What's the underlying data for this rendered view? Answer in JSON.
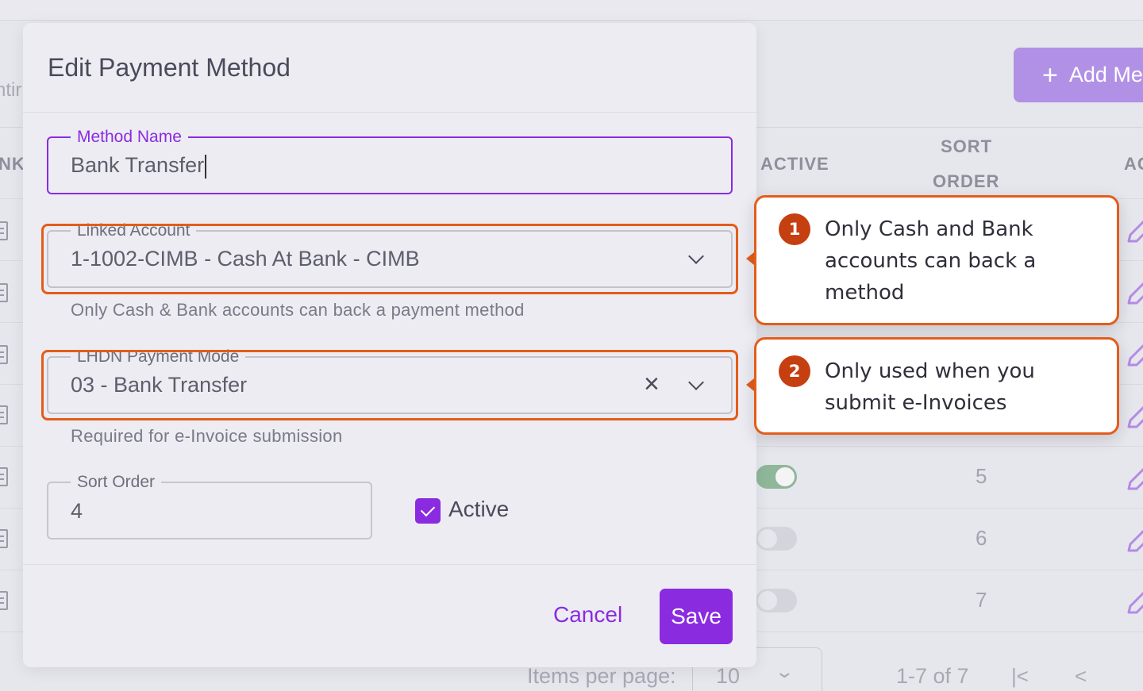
{
  "background": {
    "left_fragment": "ntir",
    "add_button_label": "Add Me",
    "add_button_icon": "plus-icon",
    "columns": {
      "left": "NK",
      "active": "ACTIVE",
      "sort_order_line1": "SORT",
      "sort_order_line2": "ORDER",
      "actions": "AC"
    },
    "rows": [
      {
        "sort": "",
        "active": null
      },
      {
        "sort": "",
        "active": null
      },
      {
        "sort": "",
        "active": null
      },
      {
        "sort": "",
        "active": null
      },
      {
        "sort": "5",
        "active": true
      },
      {
        "sort": "6",
        "active": false
      },
      {
        "sort": "7",
        "active": false
      }
    ],
    "footer": {
      "items_per_page_label": "Items per page:",
      "items_per_page_value": "10",
      "range": "1-7 of 7"
    }
  },
  "dialog": {
    "title": "Edit Payment Method",
    "method_name": {
      "label": "Method Name",
      "value": "Bank Transfer"
    },
    "linked_account": {
      "label": "Linked Account",
      "value": "1-1002-CIMB - Cash At Bank - CIMB",
      "helper": "Only Cash & Bank accounts can back a payment method"
    },
    "lhdn_payment_mode": {
      "label": "LHDN Payment Mode",
      "value": "03 - Bank Transfer",
      "helper": "Required for e-Invoice submission"
    },
    "sort_order": {
      "label": "Sort Order",
      "value": "4"
    },
    "active": {
      "label": "Active",
      "checked": true
    },
    "cancel_label": "Cancel",
    "save_label": "Save"
  },
  "callouts": [
    {
      "number": "1",
      "lines": [
        "Only Cash and Bank",
        "accounts can back a",
        "method"
      ]
    },
    {
      "number": "2",
      "lines": [
        "Only used when you",
        "submit e-Invoices"
      ]
    }
  ],
  "colors": {
    "accent": "#8b2be0",
    "highlight": "#e35d1a",
    "badge": "#c63f10"
  }
}
